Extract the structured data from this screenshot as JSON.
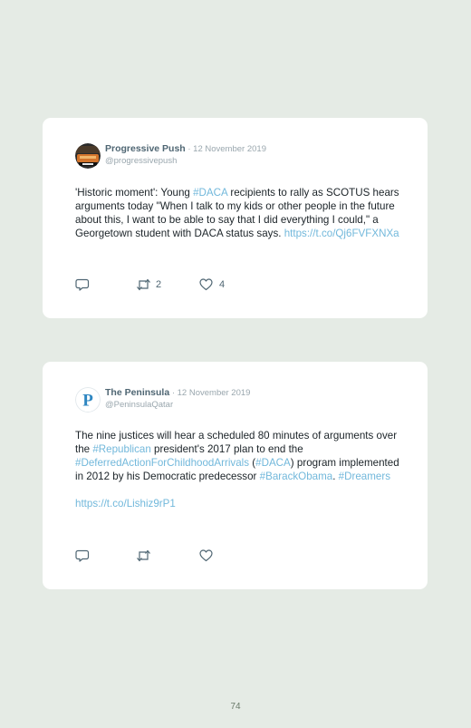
{
  "tweets": [
    {
      "author": "Progressive Push",
      "separator": " · ",
      "date": "12 November 2019",
      "handle": "@progressivepush",
      "avatar_icon": "progressive-push-avatar",
      "text": {
        "t1": "'Historic moment': Young ",
        "h1": "#DACA",
        "t2": " recipients to rally as SCOTUS hears arguments today \"When I talk to my kids or other people in the future about this, I want to be able to say that I did everything I could,\" a Georgetown student with DACA status says. ",
        "link": "https://t.co/Qj6FVFXNXa"
      },
      "retweets": "2",
      "likes": "4"
    },
    {
      "author": "The Peninsula",
      "separator": " · ",
      "date": "12 November 2019",
      "handle": "@PeninsulaQatar",
      "avatar_icon": "the-peninsula-logo",
      "avatar_letter": "P",
      "text": {
        "t1": "The nine justices will hear a scheduled 80 minutes of arguments over the ",
        "h1": "#Republican",
        "t2": " president's 2017 plan to end the ",
        "h2": "#DeferredActionForChildhoodArrivals",
        "t3": " (",
        "h3": "#DACA",
        "t4": ") program implemented in 2012 by his Democratic predecessor ",
        "h4": "#BarackObama",
        "t5": ". ",
        "h5": "#Dreamers",
        "link": "https://t.co/Lishiz9rP1"
      },
      "retweets": "",
      "likes": ""
    }
  ],
  "icons": {
    "reply": "reply-icon",
    "retweet": "retweet-icon",
    "like": "heart-icon"
  },
  "colors": {
    "page_background": "#e5ebe5",
    "card_background": "#ffffff",
    "link": "#72b8db",
    "author": "#4f6673",
    "muted": "#9aa7ae",
    "peninsula_blue": "#2e86c1"
  },
  "page_number": "74"
}
